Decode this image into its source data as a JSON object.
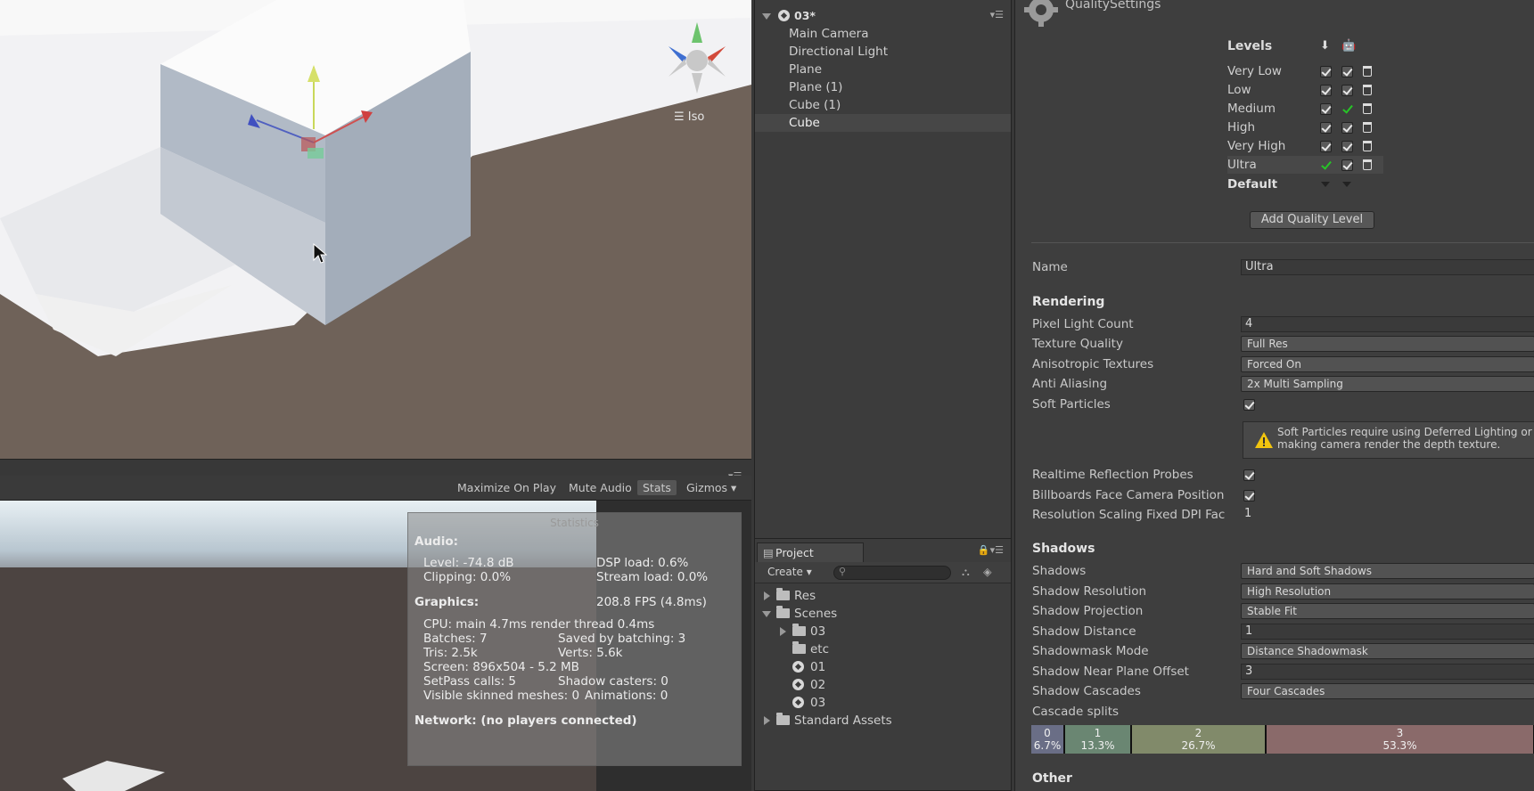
{
  "scene": {
    "projection_label": "Iso"
  },
  "game_toolbar": {
    "maximize_on_play": "Maximize On Play",
    "mute_audio": "Mute Audio",
    "stats": "Stats",
    "gizmos": "Gizmos"
  },
  "stats": {
    "title": "Statistics",
    "audio_header": "Audio:",
    "level": "Level: -74.8 dB",
    "clipping": "Clipping: 0.0%",
    "dsp_load": "DSP load: 0.6%",
    "stream_load": "Stream load: 0.0%",
    "graphics_header": "Graphics:",
    "fps": "208.8 FPS (4.8ms)",
    "cpu": "CPU: main 4.7ms  render thread 0.4ms",
    "batches": "Batches: 7",
    "saved_batching": "Saved by batching: 3",
    "tris": "Tris: 2.5k",
    "verts": "Verts: 5.6k",
    "screen": "Screen: 896x504 - 5.2 MB",
    "setpass": "SetPass calls: 5",
    "shadow_casters": "Shadow casters: 0",
    "skinned": "Visible skinned meshes: 0",
    "animations": "Animations: 0",
    "network": "Network: (no players connected)"
  },
  "hierarchy": {
    "scene_name": "03*",
    "items": [
      "Main Camera",
      "Directional Light",
      "Plane",
      "Plane (1)",
      "Cube (1)",
      "Cube"
    ],
    "selected": "Cube"
  },
  "project": {
    "tab_label": "Project",
    "create_label": "Create ▾",
    "search_value": "",
    "tree": {
      "res": "Res",
      "scenes": "Scenes",
      "folder_03": "03",
      "folder_etc": "etc",
      "scene_01": "01",
      "scene_02": "02",
      "scene_03": "03",
      "standard_assets": "Standard Assets"
    }
  },
  "inspector": {
    "title": "QualitySettings",
    "levels_header": "Levels",
    "levels": [
      "Very Low",
      "Low",
      "Medium",
      "High",
      "Very High",
      "Ultra"
    ],
    "default_label": "Default",
    "add_level": "Add Quality Level",
    "name_label": "Name",
    "name_value": "Ultra",
    "rendering_header": "Rendering",
    "pixel_light_count_label": "Pixel Light Count",
    "pixel_light_count_value": "4",
    "texture_quality_label": "Texture Quality",
    "texture_quality_value": "Full Res",
    "anisotropic_label": "Anisotropic Textures",
    "anisotropic_value": "Forced On",
    "anti_aliasing_label": "Anti Aliasing",
    "anti_aliasing_value": "2x Multi Sampling",
    "soft_particles_label": "Soft Particles",
    "soft_particles_warning": "Soft Particles require using Deferred Lighting or making camera render the depth texture.",
    "realtime_reflection_label": "Realtime Reflection Probes",
    "billboards_label": "Billboards Face Camera Position",
    "resolution_scaling_label": "Resolution Scaling Fixed DPI Fac",
    "resolution_scaling_value": "1",
    "shadows_header": "Shadows",
    "shadows_label": "Shadows",
    "shadows_value": "Hard and Soft Shadows",
    "shadow_resolution_label": "Shadow Resolution",
    "shadow_resolution_value": "High Resolution",
    "shadow_projection_label": "Shadow Projection",
    "shadow_projection_value": "Stable Fit",
    "shadow_distance_label": "Shadow Distance",
    "shadow_distance_value": "1",
    "shadowmask_label": "Shadowmask Mode",
    "shadowmask_value": "Distance Shadowmask",
    "near_plane_label": "Shadow Near Plane Offset",
    "near_plane_value": "3",
    "cascades_label": "Shadow Cascades",
    "cascades_value": "Four Cascades",
    "cascade_splits_label": "Cascade splits",
    "cascade_splits": [
      {
        "index": "0",
        "percent": "6.7%",
        "fraction": 0.067,
        "color": "#6a6e86"
      },
      {
        "index": "1",
        "percent": "13.3%",
        "fraction": 0.133,
        "color": "#6a8672"
      },
      {
        "index": "2",
        "percent": "26.7%",
        "fraction": 0.267,
        "color": "#818a6a"
      },
      {
        "index": "3",
        "percent": "53.3%",
        "fraction": 0.533,
        "color": "#8a6a6a"
      }
    ],
    "other_header": "Other"
  },
  "colors": {
    "green_check": "#27c427",
    "warning": "#f1c40f"
  }
}
